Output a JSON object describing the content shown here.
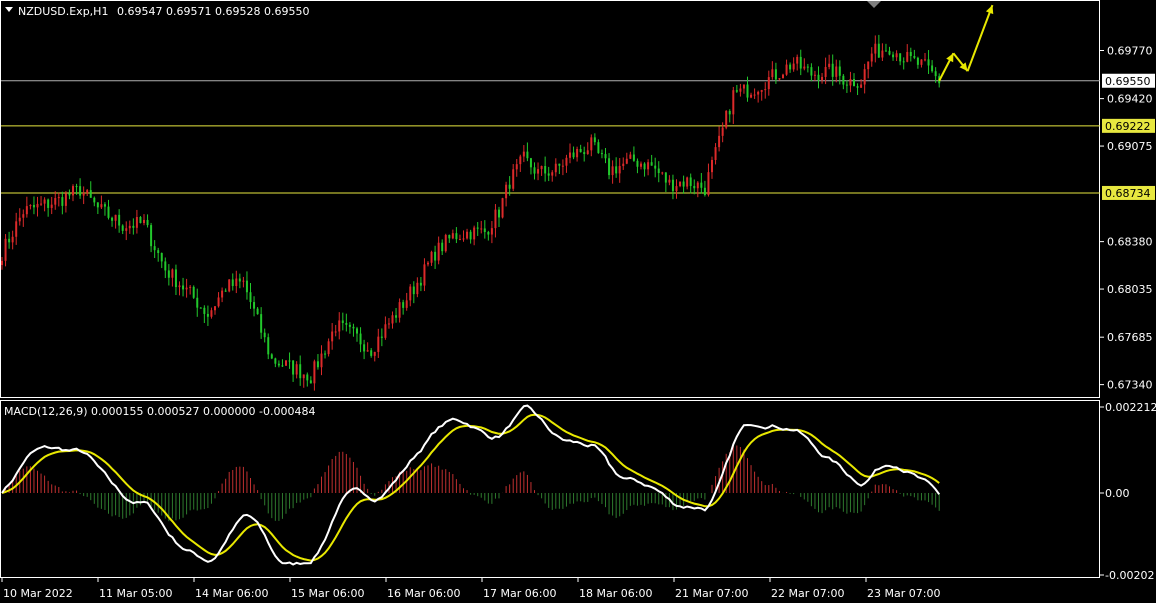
{
  "header": {
    "symbol": "NZDUSD.Exp,H1",
    "ohlc": "0.69547 0.69571 0.69528 0.69550"
  },
  "macd_header": {
    "title": "MACD(12,26,9) 0.000155 0.000527 0.000000 -0.000484"
  },
  "colors": {
    "background": "#000000",
    "frame": "#ffffff",
    "bull_candle": "#dc2a2a",
    "bear_candle": "#22c92c",
    "level_line": "#e8e840",
    "current_line": "#b0b0b0",
    "macd_line": "#ffffff",
    "signal_line": "#e8e800",
    "hist_positive": "#c03030",
    "hist_negative": "#2e7a2e",
    "arrow": "#e8e800",
    "price_tag_bg": "#e8e840"
  },
  "chart_data": [
    {
      "type": "candlestick",
      "title": "NZDUSD.Exp,H1",
      "ylim": [
        0.6725,
        0.7013
      ],
      "y_ticks": [
        "0.69770",
        "0.69420",
        "0.69075",
        "0.68380",
        "0.68035",
        "0.67685",
        "0.67340"
      ],
      "current_price": "0.69550",
      "levels": [
        {
          "label": "0.69222",
          "value": 0.69222
        },
        {
          "label": "0.68734",
          "value": 0.68734
        }
      ],
      "x_ticks": [
        "10 Mar 2022",
        "11 Mar 05:00",
        "14 Mar 06:00",
        "15 Mar 06:00",
        "16 Mar 06:00",
        "17 Mar 06:00",
        "18 Mar 06:00",
        "21 Mar 07:00",
        "22 Mar 07:00",
        "23 Mar 07:00"
      ],
      "path_anchors": [
        [
          0,
          0.683
        ],
        [
          6,
          0.686
        ],
        [
          16,
          0.6868
        ],
        [
          22,
          0.6876
        ],
        [
          27,
          0.6862
        ],
        [
          34,
          0.685
        ],
        [
          40,
          0.6851
        ],
        [
          46,
          0.6818
        ],
        [
          53,
          0.68
        ],
        [
          58,
          0.6785
        ],
        [
          63,
          0.6805
        ],
        [
          68,
          0.6808
        ],
        [
          73,
          0.6773
        ],
        [
          76,
          0.6752
        ],
        [
          83,
          0.6745
        ],
        [
          87,
          0.674
        ],
        [
          90,
          0.6755
        ],
        [
          94,
          0.6777
        ],
        [
          99,
          0.677
        ],
        [
          104,
          0.676
        ],
        [
          108,
          0.6775
        ],
        [
          113,
          0.6793
        ],
        [
          118,
          0.6812
        ],
        [
          122,
          0.683
        ],
        [
          127,
          0.6842
        ],
        [
          132,
          0.6845
        ],
        [
          136,
          0.6845
        ],
        [
          140,
          0.686
        ],
        [
          143,
          0.6882
        ],
        [
          147,
          0.6898
        ],
        [
          151,
          0.6888
        ],
        [
          156,
          0.689
        ],
        [
          160,
          0.69
        ],
        [
          166,
          0.6908
        ],
        [
          171,
          0.689
        ],
        [
          178,
          0.6897
        ],
        [
          183,
          0.6893
        ],
        [
          188,
          0.688
        ],
        [
          193,
          0.6882
        ],
        [
          198,
          0.6877
        ],
        [
          202,
          0.691
        ],
        [
          206,
          0.6945
        ],
        [
          212,
          0.695
        ],
        [
          217,
          0.6958
        ],
        [
          223,
          0.6968
        ],
        [
          228,
          0.696
        ],
        [
          234,
          0.6962
        ],
        [
          238,
          0.6955
        ],
        [
          242,
          0.6955
        ],
        [
          245,
          0.6975
        ],
        [
          250,
          0.698
        ],
        [
          254,
          0.6972
        ],
        [
          260,
          0.6965
        ],
        [
          264,
          0.6955
        ]
      ],
      "arrow_path": [
        [
          264,
          0.6955
        ],
        [
          268,
          0.6975
        ],
        [
          272,
          0.6962
        ],
        [
          279,
          0.701
        ]
      ]
    },
    {
      "type": "macd",
      "title": "MACD(12,26,9)",
      "params": [
        12,
        26,
        9
      ],
      "values": {
        "macd": 0.000155,
        "signal": 0.000527,
        "histogram": 0.0,
        "other": -0.000484
      },
      "ylim": [
        -0.00202,
        0.002212
      ],
      "y_ticks": [
        "0.002212",
        "0.00",
        "-0.00202"
      ]
    }
  ]
}
